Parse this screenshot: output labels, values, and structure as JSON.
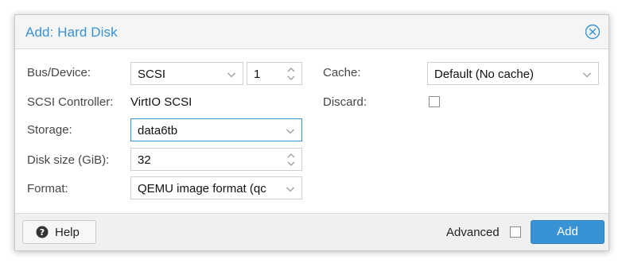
{
  "dialog": {
    "title": "Add: Hard Disk"
  },
  "form": {
    "bus_device_label": "Bus/Device:",
    "bus_value": "SCSI",
    "device_number": "1",
    "scsi_controller_label": "SCSI Controller:",
    "scsi_controller_value": "VirtIO SCSI",
    "storage_label": "Storage:",
    "storage_value": "data6tb",
    "disk_size_label": "Disk size (GiB):",
    "disk_size_value": "32",
    "format_label": "Format:",
    "format_value": "QEMU image format (qc",
    "cache_label": "Cache:",
    "cache_value": "Default (No cache)",
    "discard_label": "Discard:",
    "discard_checked": false
  },
  "footer": {
    "help_label": "Help",
    "advanced_label": "Advanced",
    "advanced_checked": false,
    "add_label": "Add"
  },
  "colors": {
    "accent": "#3892d4",
    "header_bg": "#f5f5f5",
    "footer_bg": "#f0f0f0"
  },
  "icons": {
    "close": "close-circle-icon",
    "help": "question-circle-icon",
    "dropdown": "chevron-down-icon",
    "spinner": "spinner-arrows-icon"
  }
}
